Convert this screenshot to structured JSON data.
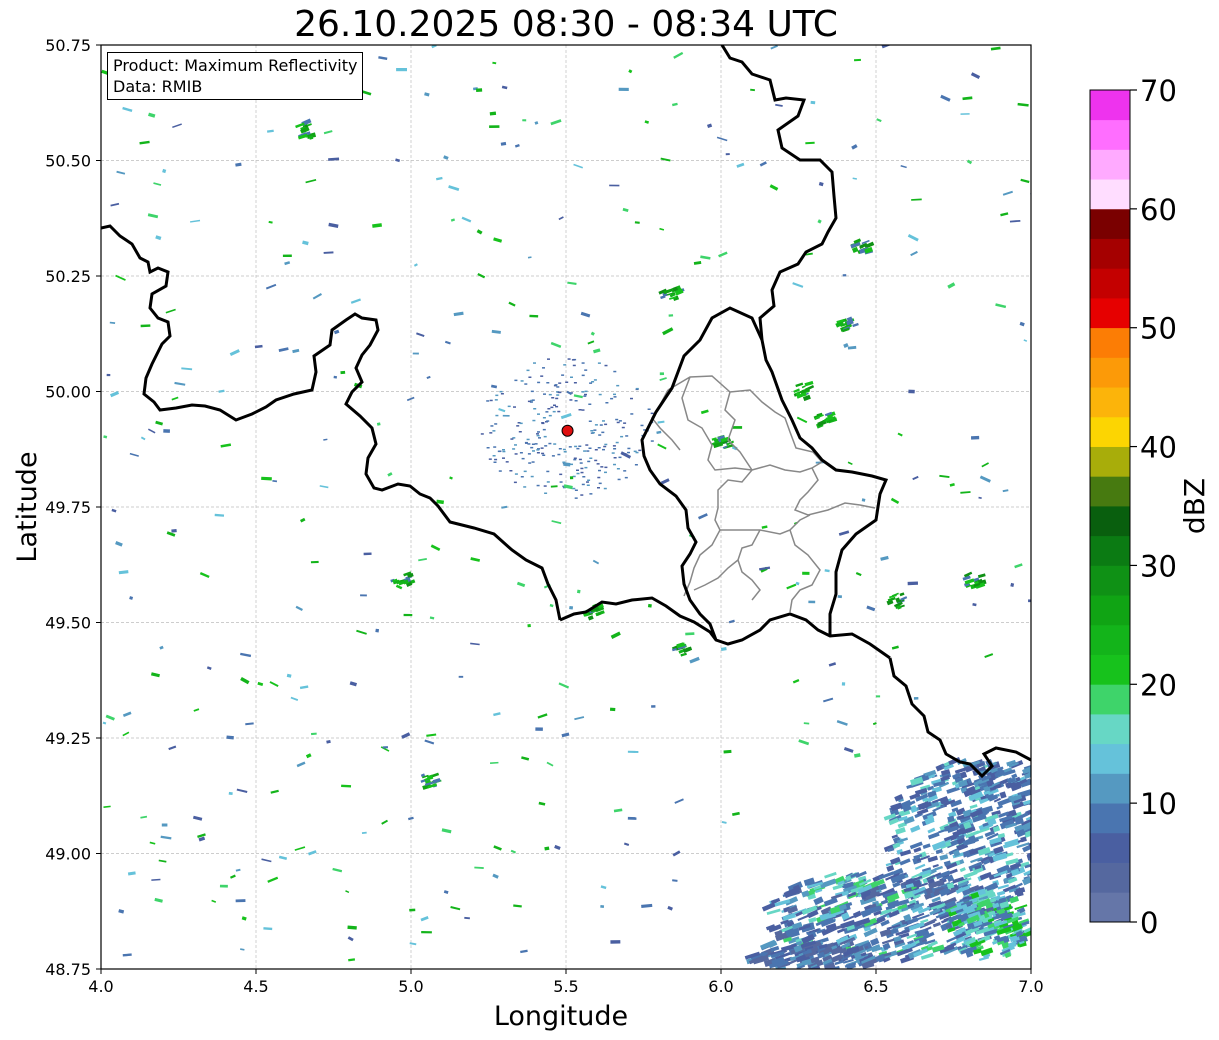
{
  "title": "26.10.2025 08:30 - 08:34 UTC",
  "info_box": {
    "line1": "Product: Maximum Reflectivity",
    "line2": "Data: RMIB"
  },
  "map": {
    "xlabel": "Longitude",
    "ylabel": "Latitude",
    "lon_range": [
      4.0,
      7.0
    ],
    "lat_range": [
      48.75,
      50.75
    ],
    "lon_ticks": [
      "4.0",
      "4.5",
      "5.0",
      "5.5",
      "6.0",
      "6.5",
      "7.0"
    ],
    "lat_ticks": [
      "50.75",
      "50.50",
      "50.25",
      "50.00",
      "49.75",
      "49.50",
      "49.25",
      "49.00",
      "48.75"
    ],
    "grid": true,
    "radar_site": {
      "lon": 5.505,
      "lat": 49.915
    }
  },
  "colorbar": {
    "label": "dBZ",
    "ticks": [
      "0",
      "10",
      "20",
      "30",
      "40",
      "50",
      "60",
      "70"
    ],
    "colors": [
      "#6576a8",
      "#55689f",
      "#4a5fa1",
      "#4a75b0",
      "#5599c1",
      "#65c2da",
      "#67d7c5",
      "#3ed46a",
      "#17c21c",
      "#13b41a",
      "#10a414",
      "#0f9115",
      "#0b7b13",
      "#095f0e",
      "#477a10",
      "#a8ad0a",
      "#fcd502",
      "#fcb40a",
      "#fc9a08",
      "#fc7d05",
      "#e60000",
      "#c40000",
      "#a50000",
      "#7a0000",
      "#ffddff",
      "#ffaaff",
      "#ff6eff",
      "#ee33ee"
    ]
  },
  "colors": {
    "border": "#000000",
    "province": "#888888",
    "grid": "#bdbdbd",
    "radar_marker": "#e01010"
  }
}
